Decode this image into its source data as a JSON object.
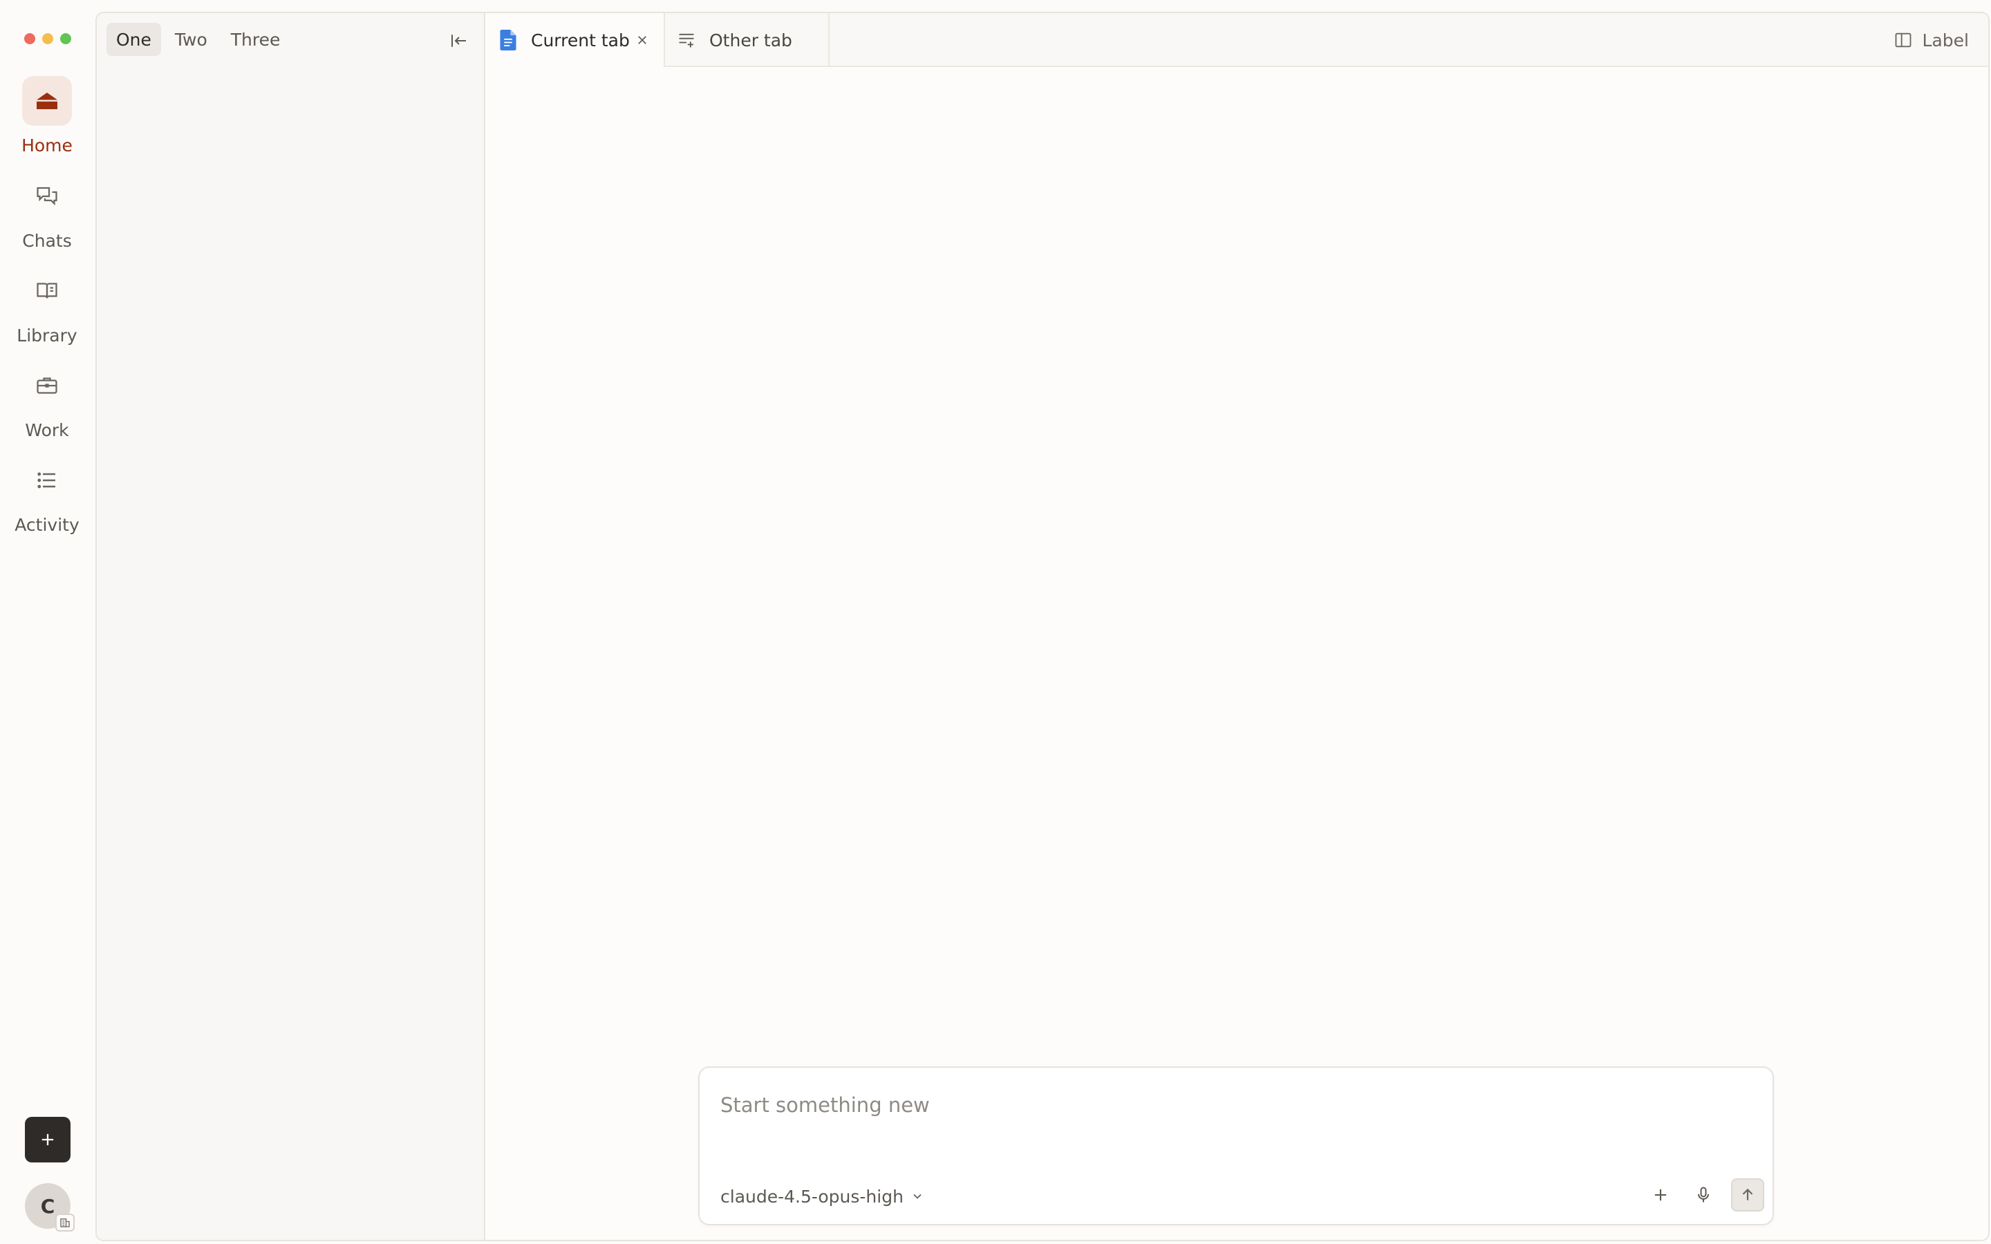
{
  "window": {
    "traffic_lights": [
      {
        "name": "close",
        "color": "#ee6a5f"
      },
      {
        "name": "minimize",
        "color": "#f5bd4f"
      },
      {
        "name": "maximize",
        "color": "#61c454"
      }
    ]
  },
  "rail": {
    "items": [
      {
        "label": "Home",
        "icon": "home-icon",
        "active": true
      },
      {
        "label": "Chats",
        "icon": "chat-bubbles-icon",
        "active": false
      },
      {
        "label": "Library",
        "icon": "book-icon",
        "active": false
      },
      {
        "label": "Work",
        "icon": "briefcase-icon",
        "active": false
      },
      {
        "label": "Activity",
        "icon": "list-icon",
        "active": false
      }
    ],
    "new_button_icon": "plus-icon",
    "avatar_initial": "C",
    "avatar_badge_icon": "building-icon"
  },
  "sidebar": {
    "tabs": [
      {
        "label": "One",
        "active": true
      },
      {
        "label": "Two",
        "active": false
      },
      {
        "label": "Three",
        "active": false
      }
    ],
    "collapse_icon": "collapse-left-icon"
  },
  "tabbar": {
    "tabs": [
      {
        "label": "Current tab",
        "icon": "doc-icon",
        "active": true
      },
      {
        "label": "Other tab",
        "icon": "text-lines-icon",
        "active": false
      }
    ],
    "right_label": "Label",
    "right_icon": "split-panel-icon"
  },
  "composer": {
    "placeholder": "Start something new",
    "value": "",
    "model": "claude-4.5-opus-high",
    "attach_icon": "plus-icon",
    "mic_icon": "microphone-icon",
    "send_icon": "arrow-up-icon"
  },
  "colors": {
    "accent": "#9a2f10",
    "accent_bg": "#f5e7df",
    "doc_blue": "#3b7ee0",
    "dark_button": "#2f2b28"
  }
}
